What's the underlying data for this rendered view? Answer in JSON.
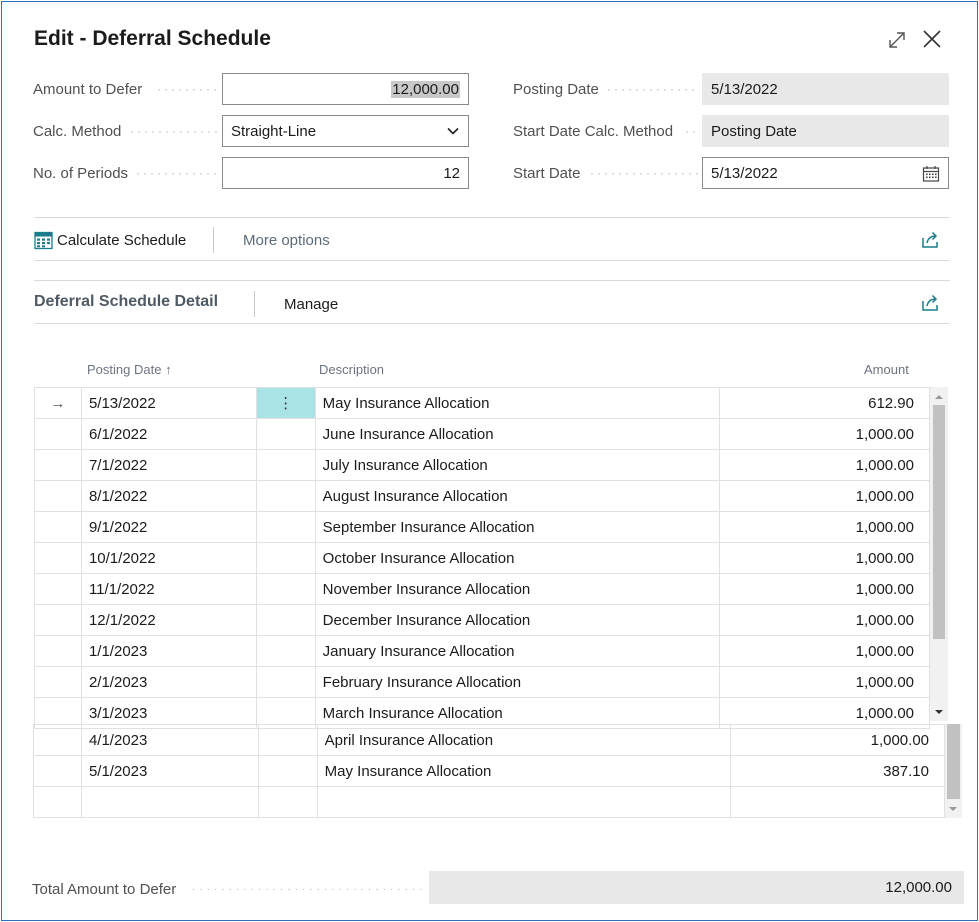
{
  "dialog": {
    "title": "Edit - Deferral Schedule"
  },
  "form": {
    "amount_to_defer": {
      "label": "Amount to Defer",
      "value": "12,000.00"
    },
    "calc_method": {
      "label": "Calc. Method",
      "value": "Straight-Line"
    },
    "no_of_periods": {
      "label": "No. of Periods",
      "value": "12"
    },
    "posting_date": {
      "label": "Posting Date",
      "value": "5/13/2022"
    },
    "start_date_calc_method": {
      "label": "Start Date Calc. Method",
      "value": "Posting Date"
    },
    "start_date": {
      "label": "Start Date",
      "value": "5/13/2022"
    }
  },
  "actions": {
    "calculate_schedule": "Calculate Schedule",
    "more_options": "More options"
  },
  "detail": {
    "title": "Deferral Schedule Detail",
    "manage": "Manage",
    "columns": {
      "posting_date": "Posting Date",
      "sort_indicator": "↑",
      "description": "Description",
      "amount": "Amount"
    },
    "rows": [
      {
        "date": "5/13/2022",
        "description": "May Insurance Allocation",
        "amount": "612.90"
      },
      {
        "date": "6/1/2022",
        "description": "June Insurance Allocation",
        "amount": "1,000.00"
      },
      {
        "date": "7/1/2022",
        "description": "July Insurance Allocation",
        "amount": "1,000.00"
      },
      {
        "date": "8/1/2022",
        "description": "August Insurance Allocation",
        "amount": "1,000.00"
      },
      {
        "date": "9/1/2022",
        "description": "September Insurance Allocation",
        "amount": "1,000.00"
      },
      {
        "date": "10/1/2022",
        "description": "October Insurance Allocation",
        "amount": "1,000.00"
      },
      {
        "date": "11/1/2022",
        "description": "November Insurance Allocation",
        "amount": "1,000.00"
      },
      {
        "date": "12/1/2022",
        "description": "December Insurance Allocation",
        "amount": "1,000.00"
      },
      {
        "date": "1/1/2023",
        "description": "January Insurance Allocation",
        "amount": "1,000.00"
      },
      {
        "date": "2/1/2023",
        "description": "February Insurance Allocation",
        "amount": "1,000.00"
      },
      {
        "date": "3/1/2023",
        "description": "March Insurance Allocation",
        "amount": "1,000.00"
      }
    ],
    "overflow_rows": [
      {
        "date": "4/1/2023",
        "description": "April Insurance Allocation",
        "amount": "1,000.00"
      },
      {
        "date": "5/1/2023",
        "description": "May Insurance Allocation",
        "amount": "387.10"
      },
      {
        "date": "",
        "description": "",
        "amount": ""
      }
    ],
    "current_row_marker": "→",
    "row_action_glyph": "⋮"
  },
  "footer": {
    "label": "Total Amount to Defer",
    "value": "12,000.00"
  },
  "colors": {
    "border": "#2e6fb8",
    "readonly": "#e8e8e8",
    "action_cell": "#a9e3e6",
    "icon_teal": "#1b7d8c"
  },
  "icons": [
    "expand-icon",
    "close-icon",
    "chevron-down-icon",
    "calendar-icon",
    "calculate-schedule-icon",
    "share-icon",
    "right-arrow-icon",
    "more-vertical-icon"
  ]
}
